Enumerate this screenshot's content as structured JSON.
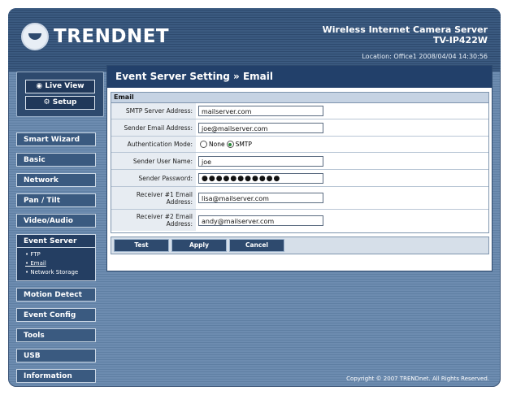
{
  "header": {
    "logo_text": "TRENDNET",
    "product_line1": "Wireless Internet Camera Server",
    "product_line2": "TV-IP422W",
    "location": "Location: Office1   2008/04/04 14:30:56"
  },
  "sidebar": {
    "live_view": "Live View",
    "setup": "Setup",
    "items": [
      "Smart Wizard",
      "Basic",
      "Network",
      "Pan / Tilt",
      "Video/Audio",
      "Event Server",
      "Motion Detect",
      "Event Config",
      "Tools",
      "USB",
      "Information"
    ],
    "sub_items": [
      "• FTP",
      "• Email",
      "• Network Storage"
    ]
  },
  "panel": {
    "title": "Event Server Setting » Email",
    "section": "Email",
    "fields": {
      "smtp_label": "SMTP Server Address:",
      "smtp_value": "mailserver.com",
      "sender_email_label": "Sender Email Address:",
      "sender_email_value": "joe@mailserver.com",
      "auth_label": "Authentication Mode:",
      "auth_none": "None",
      "auth_smtp": "SMTP",
      "user_label": "Sender User Name:",
      "user_value": "joe",
      "password_label": "Sender Password:",
      "password_value": "●●●●●●●●●●●",
      "recv1_label": "Receiver #1 Email Address:",
      "recv1_value": "lisa@mailserver.com",
      "recv2_label": "Receiver #2 Email Address:",
      "recv2_value": "andy@mailserver.com"
    },
    "buttons": {
      "test": "Test",
      "apply": "Apply",
      "cancel": "Cancel"
    }
  },
  "footer": {
    "copyright": "Copyright © 2007 TRENDnet. All Rights Reserved."
  }
}
